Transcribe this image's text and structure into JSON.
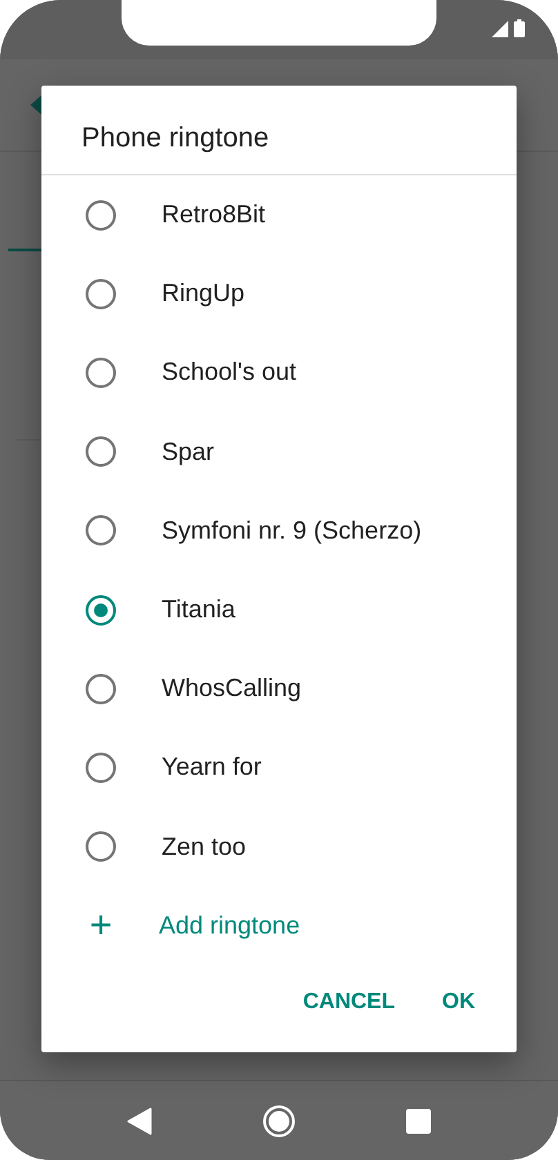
{
  "dialog": {
    "title": "Phone ringtone",
    "options": [
      {
        "label": "Retro8Bit",
        "selected": false
      },
      {
        "label": "RingUp",
        "selected": false
      },
      {
        "label": "School's out",
        "selected": false
      },
      {
        "label": "Spar",
        "selected": false
      },
      {
        "label": "Symfoni nr. 9 (Scherzo)",
        "selected": false
      },
      {
        "label": "Titania",
        "selected": true
      },
      {
        "label": "WhosCalling",
        "selected": false
      },
      {
        "label": "Yearn for",
        "selected": false
      },
      {
        "label": "Zen too",
        "selected": false
      }
    ],
    "add": {
      "icon": "+",
      "label": "Add ringtone"
    },
    "buttons": [
      "CANCEL",
      "OK"
    ]
  }
}
